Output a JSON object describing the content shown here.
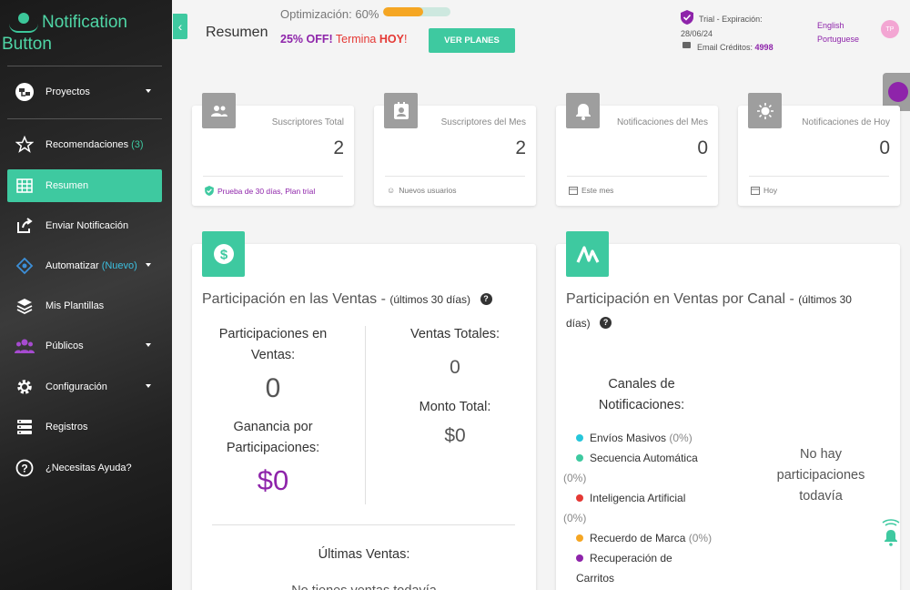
{
  "app": {
    "logo_line1": "Notification",
    "logo_line2": "Button"
  },
  "sidebar": {
    "items": [
      {
        "label": "Proyectos",
        "icon": "projects-icon"
      },
      {
        "label": "Recomendaciones",
        "count": "(3)",
        "icon": "star-icon"
      },
      {
        "label": "Resumen",
        "icon": "grid-icon",
        "active": true
      },
      {
        "label": "Enviar Notificación",
        "icon": "share-icon"
      },
      {
        "label": "Automatizar",
        "badge": "(Nuevo)",
        "icon": "automation-icon"
      },
      {
        "label": "Mis Plantillas",
        "icon": "layers-icon"
      },
      {
        "label": "Públicos",
        "icon": "users-icon"
      },
      {
        "label": "Configuración",
        "icon": "gear-icon"
      },
      {
        "label": "Registros",
        "icon": "records-icon"
      },
      {
        "label": "¿Necesitas Ayuda?",
        "icon": "help-icon"
      }
    ]
  },
  "header": {
    "title": "Resumen",
    "optimization_label": "Optimización: 60%",
    "optimization_progress": 0.6,
    "promo_off": "25% OFF!",
    "promo_ends": "Termina",
    "promo_today": "HOY",
    "promo_bang": "!",
    "plans_button": "VER PLANES",
    "trial_label": "Trial - Expiración:",
    "trial_date": "28/06/24",
    "credits_label": "Email Créditos:",
    "credits_value": "4998",
    "lang_en": "English",
    "lang_pt": "Portuguese",
    "avatar_initials": "TP"
  },
  "stats": [
    {
      "label": "Suscriptores Total",
      "value": "2",
      "footer": "Prueba de 30 días, Plan trial",
      "icon": "users-icon",
      "footer_icon": "shield-check-icon"
    },
    {
      "label": "Suscriptores del Mes",
      "value": "2",
      "footer": "Nuevos usuarios",
      "icon": "contact-icon",
      "footer_icon": "smile-icon"
    },
    {
      "label": "Notificaciones del Mes",
      "value": "0",
      "footer": "Este mes",
      "icon": "bell-icon",
      "footer_icon": "calendar-icon"
    },
    {
      "label": "Notificaciones de Hoy",
      "value": "0",
      "footer": "Hoy",
      "icon": "sun-icon",
      "footer_icon": "calendar-icon"
    }
  ],
  "sales": {
    "title": "Participación en las Ventas -",
    "period": "(últimos 30 días)",
    "participations_label": "Participaciones en Ventas:",
    "participations_value": "0",
    "gain_label": "Ganancia por Participaciones:",
    "gain_value": "$0",
    "total_sales_label": "Ventas Totales:",
    "total_sales_value": "0",
    "total_amount_label": "Monto Total:",
    "total_amount_value": "$0",
    "latest_label": "Últimas Ventas:",
    "latest_empty": "No tienes ventas todavía"
  },
  "channels": {
    "title": "Participación en Ventas por Canal -",
    "period_a": "(últimos 30",
    "period_b": "días)",
    "legend_title": "Canales de Notificaciones:",
    "legend": [
      {
        "label": "Envíos Masivos",
        "pct": "(0%)",
        "color": "#26c6da"
      },
      {
        "label": "Secuencia Automática",
        "pct": "(0%)",
        "color": "#3ec9a0"
      },
      {
        "label": "Inteligencia Artificial",
        "pct": "(0%)",
        "color": "#e53935"
      },
      {
        "label": "Recuerdo de Marca",
        "pct": "(0%)",
        "color": "#f5a623"
      },
      {
        "label": "Recuperación de Carritos",
        "pct": "",
        "color": "#8e24aa"
      }
    ],
    "empty": "No hay participaciones todavía"
  },
  "colors": {
    "accent": "#3ec9a0",
    "purple": "#8e24aa",
    "red": "#e53935",
    "orange": "#f5a623"
  }
}
